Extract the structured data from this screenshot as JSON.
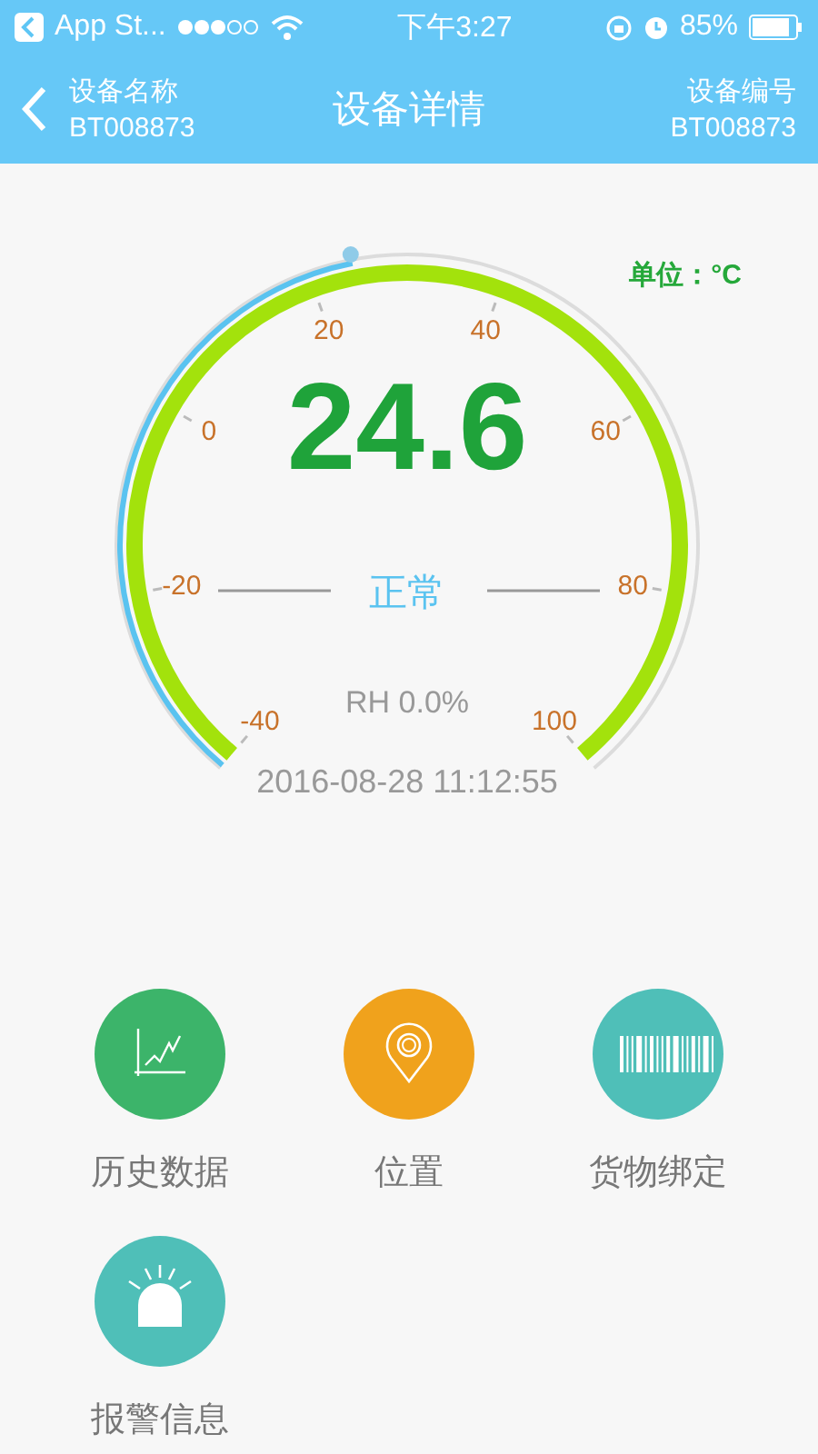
{
  "status_bar": {
    "back_app": "App St...",
    "time": "下午3:27",
    "battery": "85%"
  },
  "nav": {
    "left_label": "设备名称",
    "left_value": "BT008873",
    "title": "设备详情",
    "right_label": "设备编号",
    "right_value": "BT008873"
  },
  "gauge": {
    "unit": "单位：°C",
    "value": "24.6",
    "status": "正常",
    "humidity": "RH 0.0%",
    "timestamp": "2016-08-28 11:12:55",
    "ticks": [
      "-40",
      "-20",
      "0",
      "20",
      "40",
      "60",
      "80",
      "100"
    ]
  },
  "actions": [
    {
      "label": "历史数据",
      "kind": "chart",
      "color": "#3cb46a"
    },
    {
      "label": "位置",
      "kind": "location",
      "color": "#f0a21c"
    },
    {
      "label": "货物绑定",
      "kind": "barcode",
      "color": "#4fbfb8"
    },
    {
      "label": "报警信息",
      "kind": "alarm",
      "color": "#4fbfb8"
    }
  ]
}
